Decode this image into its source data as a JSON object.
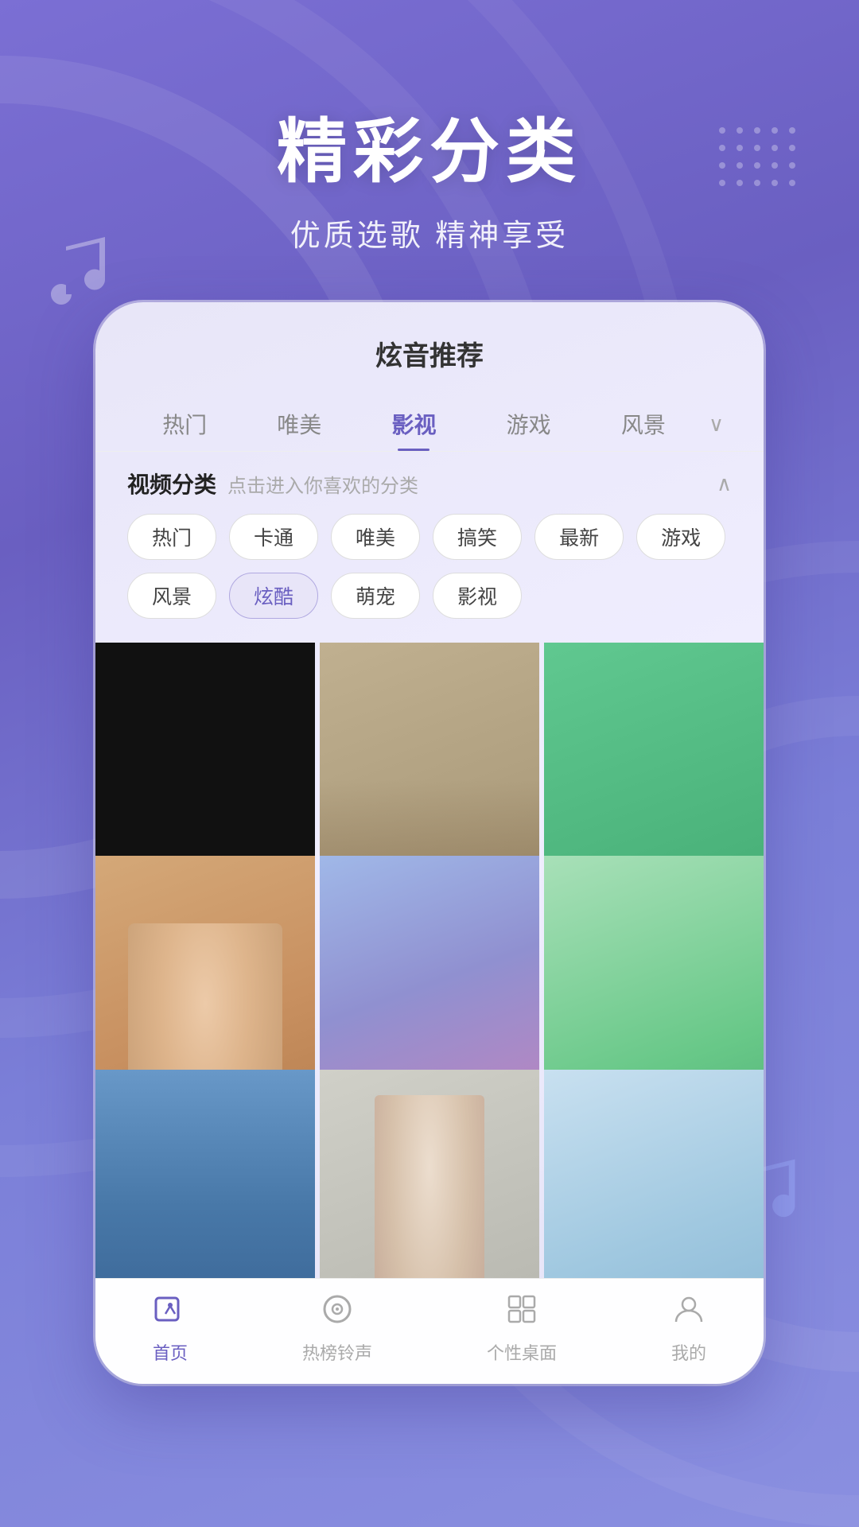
{
  "header": {
    "main_title": "精彩分类",
    "sub_title": "优质选歌 精神享受"
  },
  "app": {
    "title": "炫音推荐",
    "tabs": [
      {
        "label": "热门",
        "active": false
      },
      {
        "label": "唯美",
        "active": false
      },
      {
        "label": "影视",
        "active": true
      },
      {
        "label": "游戏",
        "active": false
      },
      {
        "label": "风景",
        "active": false
      }
    ],
    "category": {
      "title": "视频分类",
      "subtitle": "点击进入你喜欢的分类",
      "tags": [
        {
          "label": "热门",
          "active": false
        },
        {
          "label": "卡通",
          "active": false
        },
        {
          "label": "唯美",
          "active": false
        },
        {
          "label": "搞笑",
          "active": false
        },
        {
          "label": "最新",
          "active": false
        },
        {
          "label": "游戏",
          "active": false
        },
        {
          "label": "风景",
          "active": false
        },
        {
          "label": "炫酷",
          "active": true
        },
        {
          "label": "萌宠",
          "active": false
        },
        {
          "label": "影视",
          "active": false
        }
      ]
    },
    "bottom_nav": [
      {
        "label": "首页",
        "icon": "▶",
        "active": true
      },
      {
        "label": "热榜铃声",
        "icon": "♪",
        "active": false
      },
      {
        "label": "个性桌面",
        "icon": "⊞",
        "active": false
      },
      {
        "label": "我的",
        "icon": "☺",
        "active": false
      }
    ]
  },
  "icons": {
    "music_note": "♪",
    "chevron_down": "∨",
    "chevron_up": "∧"
  }
}
